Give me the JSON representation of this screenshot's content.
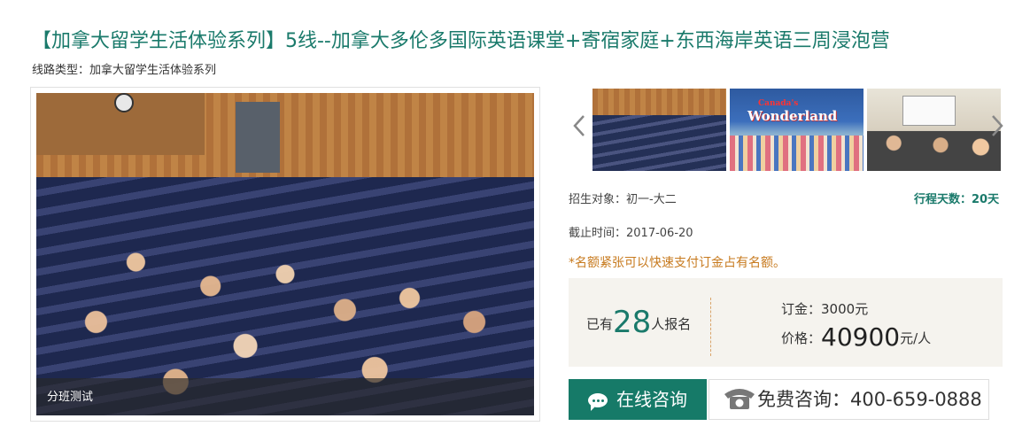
{
  "header": {
    "title": "【加拿大留学生活体验系列】5线--加拿大多伦多国际英语课堂+寄宿家庭+东西海岸英语三周浸泡营",
    "route_type_label": "线路类型：",
    "route_type_value": "加拿大留学生活体验系列"
  },
  "gallery": {
    "main_caption": "分班测试",
    "prev_label": "‹",
    "next_label": "›",
    "thumb2_sign": "Wonderland",
    "thumb2_sign_top": "Canada's"
  },
  "details": {
    "target_label": "招生对象：",
    "target_value": "初一-大二",
    "days_label": "行程天数：",
    "days_value": "20天",
    "deadline_label": "截止时间：",
    "deadline_value": "2017-06-20",
    "notice": "*名额紧张可以快速支付订金占有名额。"
  },
  "pricing": {
    "enrolled_prefix": "已有",
    "enrolled_count": "28",
    "enrolled_suffix": "人报名",
    "deposit_label": "订金：",
    "deposit_value": "3000元",
    "price_label": "价格：",
    "price_amount": "40900",
    "price_unit": "元/人"
  },
  "actions": {
    "consult_label": "在线咨询",
    "free_label": "免费咨询：",
    "phone": "400-659-0888"
  },
  "colors": {
    "brand": "#1a7a6b",
    "notice": "#c77a1e",
    "price_box_bg": "#f5f3ee"
  }
}
